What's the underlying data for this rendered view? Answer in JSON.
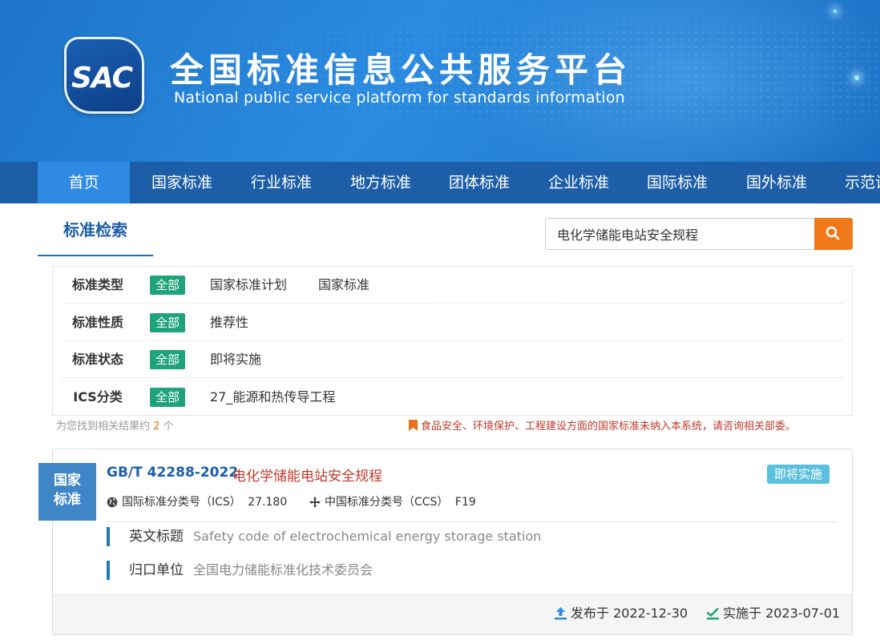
{
  "header": {
    "logo_text": "SAC",
    "title_cn": "全国标准信息公共服务平台",
    "title_en": "National public service platform  for standards information"
  },
  "nav": {
    "items": [
      "首页",
      "国家标准",
      "行业标准",
      "地方标准",
      "团体标准",
      "企业标准",
      "国际标准",
      "国外标准",
      "示范试"
    ]
  },
  "search": {
    "tab_label": "标准检索",
    "query": "电化学储能电站安全规程",
    "button_icon": "search-icon"
  },
  "filters": [
    {
      "label": "标准类型",
      "tag": "全部",
      "options": [
        "国家标准计划",
        "国家标准"
      ]
    },
    {
      "label": "标准性质",
      "tag": "全部",
      "options": [
        "推荐性"
      ]
    },
    {
      "label": "标准状态",
      "tag": "全部",
      "options": [
        "即将实施"
      ]
    },
    {
      "label": "ICS分类",
      "tag": "全部",
      "options": [
        "27_能源和热传导工程"
      ]
    }
  ],
  "results_summary": {
    "prefix": "为您找到相关结果约",
    "count": "2",
    "suffix": "个"
  },
  "notice": "食品安全、环境保护、工程建设方面的国家标准未纳入本系统，请咨询相关部委。",
  "result": {
    "type_line1": "国家",
    "type_line2": "标准",
    "code": "GB/T 42288-2022",
    "name": "电化学储能电站安全规程",
    "status": "即将实施",
    "ics_label": "国际标准分类号（ICS）",
    "ics_value": "27.180",
    "ccs_label": "中国标准分类号（CCS）",
    "ccs_value": "F19",
    "en_title_label": "英文标题",
    "en_title_value": "Safety code of electrochemical energy storage station",
    "dept_label": "归口单位",
    "dept_value": "全国电力储能标准化技术委员会",
    "publish_label": "发布于",
    "publish_date": "2022-12-30",
    "implement_label": "实施于",
    "implement_date": "2023-07-01"
  },
  "colors": {
    "nav_bg": "#1c5fa8",
    "nav_active": "#2f8ae3",
    "tag_green": "#1fa37a",
    "search_orange": "#f07a1a",
    "status_blue": "#5bc0de",
    "title_red": "#c0392b"
  }
}
